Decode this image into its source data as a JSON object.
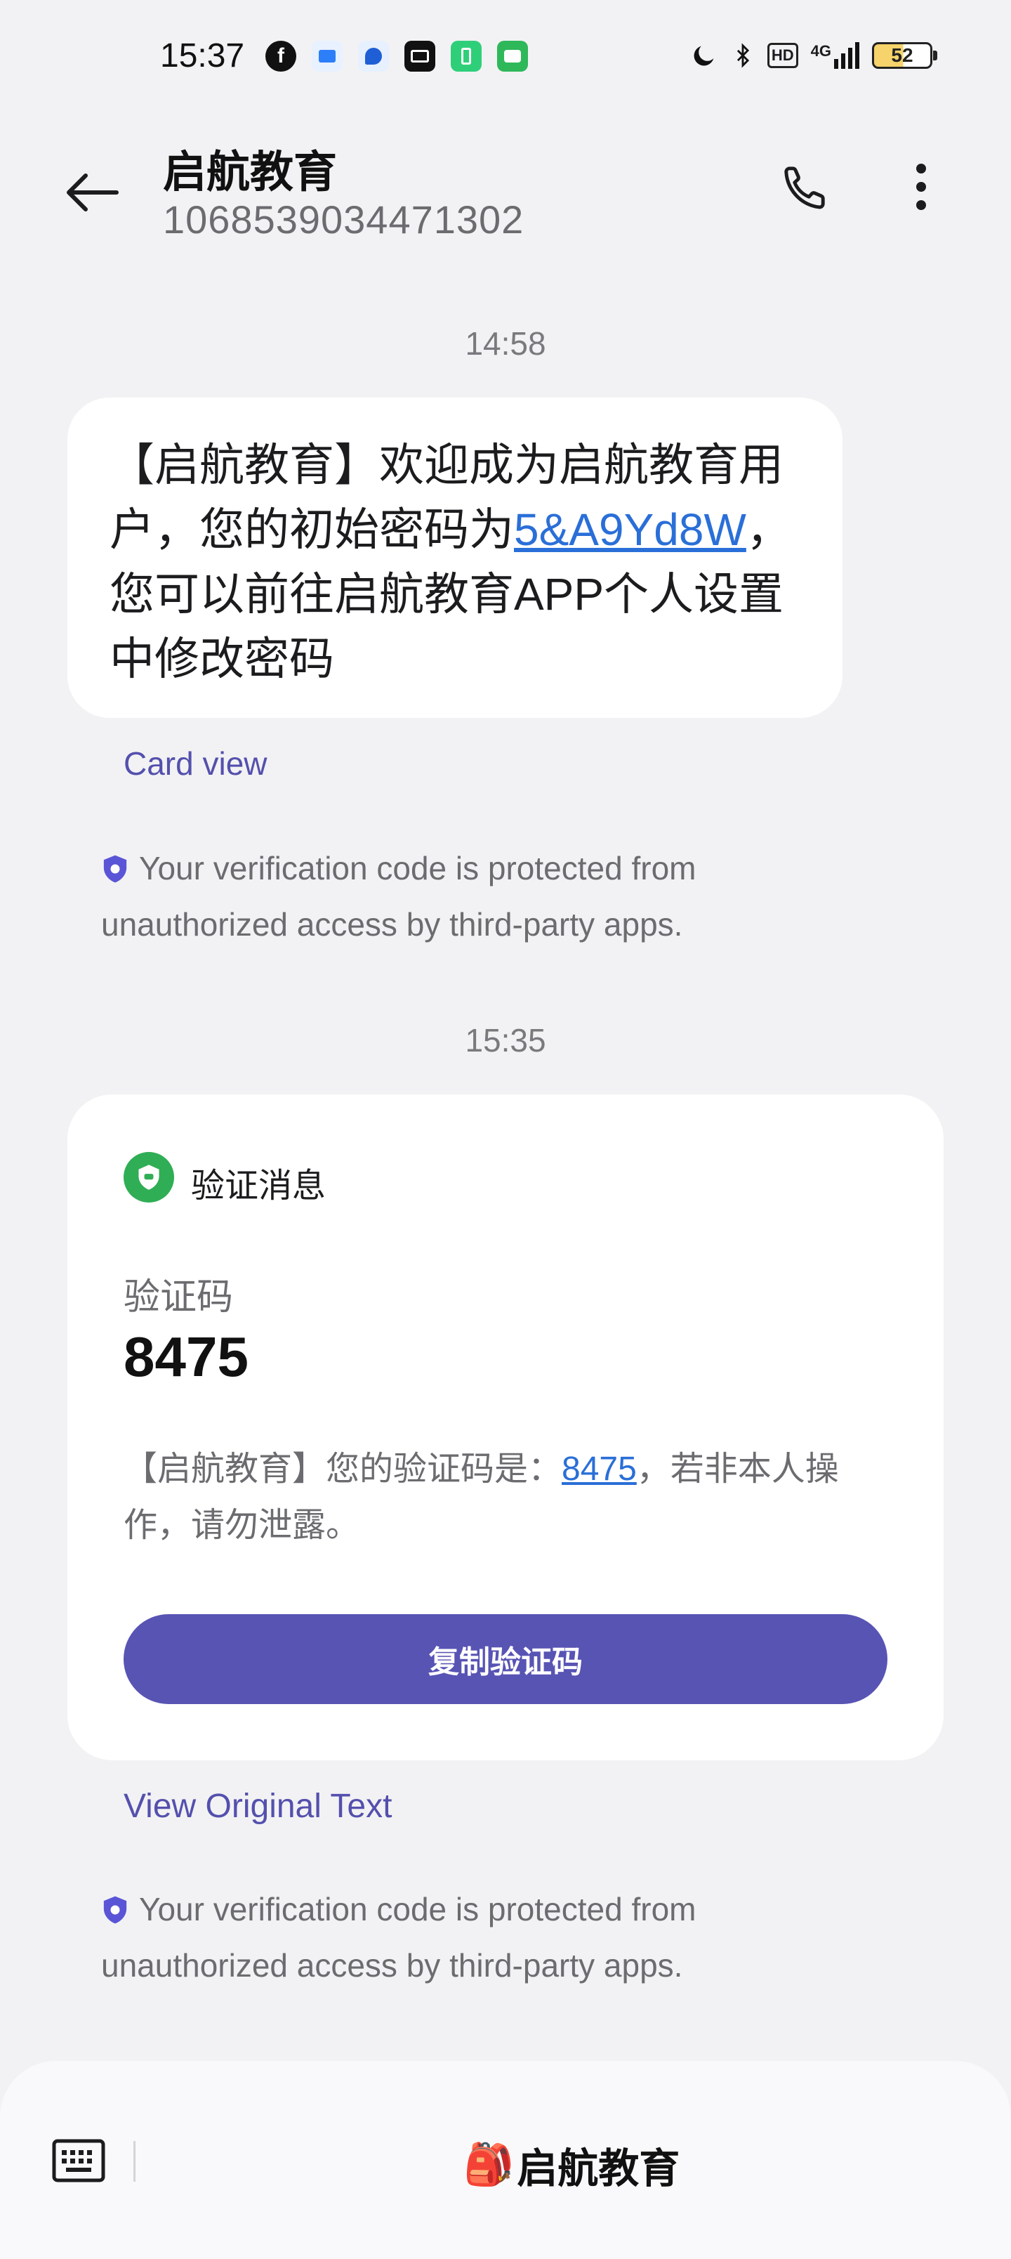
{
  "status_bar": {
    "time": "15:37",
    "notification_icons": [
      "facebook-icon",
      "app-icon",
      "messenger-icon",
      "mail-icon",
      "battery-saver-icon",
      "messages-icon"
    ],
    "system_icons": [
      "moon-icon",
      "bluetooth-icon",
      "hd-icon",
      "4g-signal-icon"
    ],
    "hd_label": "HD",
    "network_label": "4G",
    "battery_level": "52"
  },
  "header": {
    "contact_name": "启航教育",
    "contact_number": "1068539034471302"
  },
  "messages": [
    {
      "timestamp": "14:58",
      "text_before_link": "【启航教育】欢迎成为启航教育用户，您的初始密码为",
      "link_text": "5&A9Yd8W",
      "text_after_link": "，您可以前往启航教育APP个人设置中修改密码",
      "card_view_label": "Card view",
      "protection_notice": "Your verification code is protected from unauthorized access by third-party apps."
    },
    {
      "timestamp": "15:35",
      "card_title": "验证消息",
      "code_label": "验证码",
      "code_value": "8475",
      "body_before_link": "【启航教育】您的验证码是：",
      "body_link": "8475",
      "body_after_link": "，若非本人操作，请勿泄露。",
      "copy_button_label": "复制验证码",
      "view_original_label": "View Original Text",
      "protection_notice": "Your verification code is protected from unauthorized access by third-party apps."
    }
  ],
  "bottom_bar": {
    "brand_emoji": "🎒",
    "brand_name": "启航教育"
  },
  "colors": {
    "accent": "#5854b4",
    "link": "#2a6fd8",
    "shield_green": "#2fae55",
    "background": "#f2f2f4"
  }
}
